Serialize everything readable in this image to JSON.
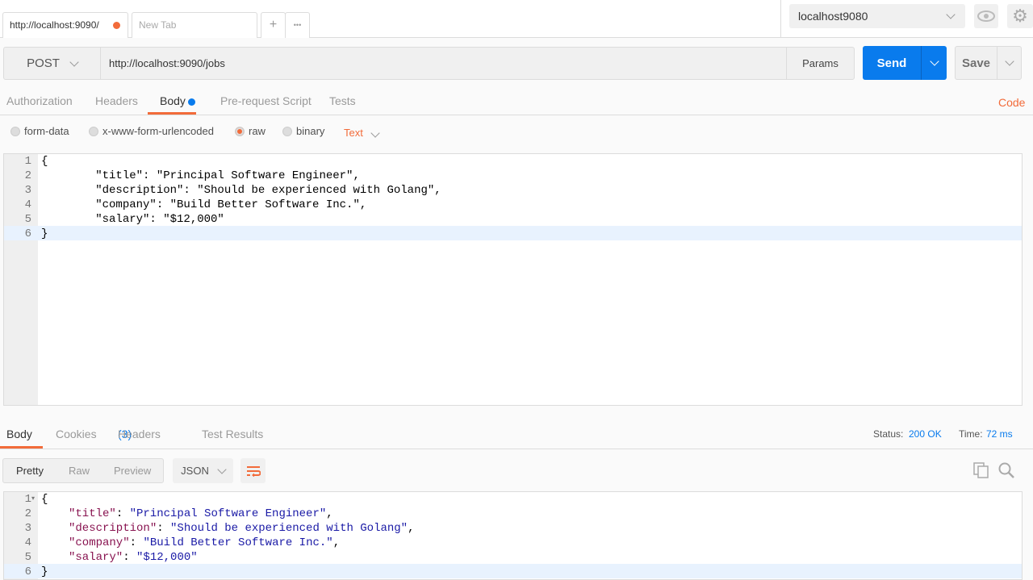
{
  "tabs": [
    {
      "label": "http://localhost:9090/"
    },
    {
      "label": "New Tab"
    }
  ],
  "tab_actions": {
    "add": "+",
    "more": "•••"
  },
  "environment": {
    "selected": "localhost9080"
  },
  "request": {
    "method": "POST",
    "url": "http://localhost:9090/jobs",
    "params": "Params",
    "send": "Send",
    "save": "Save"
  },
  "request_tabs": [
    {
      "label": "Authorization"
    },
    {
      "label": "Headers"
    },
    {
      "label": "Body"
    },
    {
      "label": "Pre-request Script"
    },
    {
      "label": "Tests"
    }
  ],
  "code_link": "Code",
  "body_modes": [
    {
      "label": "form-data"
    },
    {
      "label": "x-www-form-urlencoded"
    },
    {
      "label": "raw"
    },
    {
      "label": "binary"
    }
  ],
  "body_type": "Text",
  "request_body": [
    {
      "n": "1",
      "text": "{"
    },
    {
      "n": "2",
      "text": "        \"title\": \"Principal Software Engineer\","
    },
    {
      "n": "3",
      "text": "        \"description\": \"Should be experienced with Golang\","
    },
    {
      "n": "4",
      "text": "        \"company\": \"Build Better Software Inc.\","
    },
    {
      "n": "5",
      "text": "        \"salary\": \"$12,000\""
    },
    {
      "n": "6",
      "text": "}"
    }
  ],
  "response_tabs": {
    "body": "Body",
    "cookies": "Cookies",
    "headers": "Headers",
    "headers_count": "(3)",
    "tests": "Test Results"
  },
  "status": {
    "label": "Status:",
    "value": "200 OK",
    "time_label": "Time:",
    "time_value": "72 ms"
  },
  "view_modes": {
    "pretty": "Pretty",
    "raw": "Raw",
    "preview": "Preview"
  },
  "format": "JSON",
  "response_body": {
    "lines": [
      "1",
      "2",
      "3",
      "4",
      "5",
      "6"
    ],
    "open": "{",
    "close": "}",
    "fields": [
      {
        "key": "\"title\"",
        "value": "\"Principal Software Engineer\"",
        "comma": ","
      },
      {
        "key": "\"description\"",
        "value": "\"Should be experienced with Golang\"",
        "comma": ","
      },
      {
        "key": "\"company\"",
        "value": "\"Build Better Software Inc.\"",
        "comma": ","
      },
      {
        "key": "\"salary\"",
        "value": "\"$12,000\"",
        "comma": ""
      }
    ]
  },
  "colors": {
    "accent": "#f26b3a",
    "send": "#097bed",
    "link": "#097bed"
  }
}
